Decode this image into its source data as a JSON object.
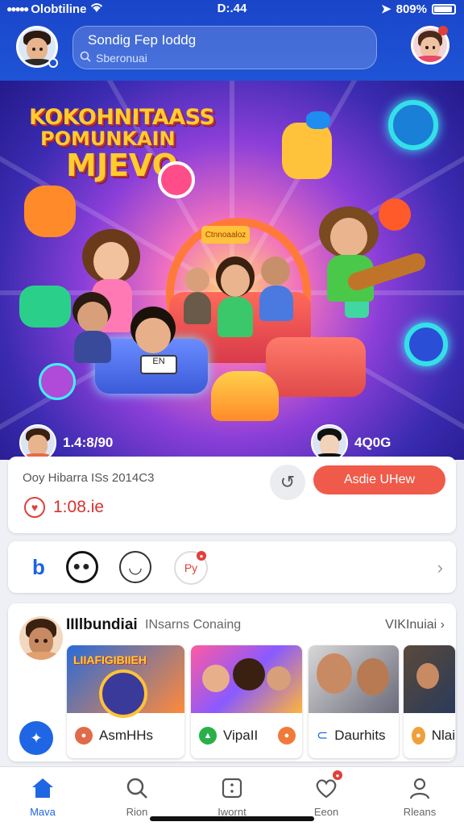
{
  "status": {
    "carrier": "Olobtiline",
    "time": "D:.44",
    "battery": "809%"
  },
  "header": {
    "title": "Sondig Fep Ioddg",
    "search_placeholder": "Sberonuai"
  },
  "hero": {
    "title_line1": "KOKOHNITAASS",
    "title_line2": "POMUNKAIN",
    "title_line3": "MJEVO",
    "sign_text": "Ctnnoaaloz",
    "tv_text": "EN",
    "left_user_count": "1.4:8/90",
    "right_user_count": "4Q0G"
  },
  "post": {
    "meta": "Ooy Hibarra ISs 2014C3",
    "likes": "1:08.ie",
    "action_label": "Asdie UHew"
  },
  "icon_row": {
    "heart_icon_text": "Py"
  },
  "feed": {
    "name": "IIIlbundiai",
    "subtitle": "INsarns Conaing",
    "link": "VIKInuiai",
    "thumbs": [
      {
        "label": "AsmHHs",
        "image_text": "LIIAFIGIBIIEH"
      },
      {
        "label": "VipaII",
        "image_text": ""
      },
      {
        "label": "Daurhits",
        "image_text": ""
      },
      {
        "label": "Nlai",
        "image_text": ""
      }
    ]
  },
  "nav": [
    {
      "label": "Mava",
      "icon": "home-icon"
    },
    {
      "label": "Rion",
      "icon": "search-icon"
    },
    {
      "label": "Iwornt",
      "icon": "dice-icon"
    },
    {
      "label": "Eeon",
      "icon": "heart-icon"
    },
    {
      "label": "Rleans",
      "icon": "profile-icon"
    }
  ],
  "colors": {
    "brand": "#1f54d6",
    "accent": "#f05a4a",
    "like": "#d6322f"
  }
}
